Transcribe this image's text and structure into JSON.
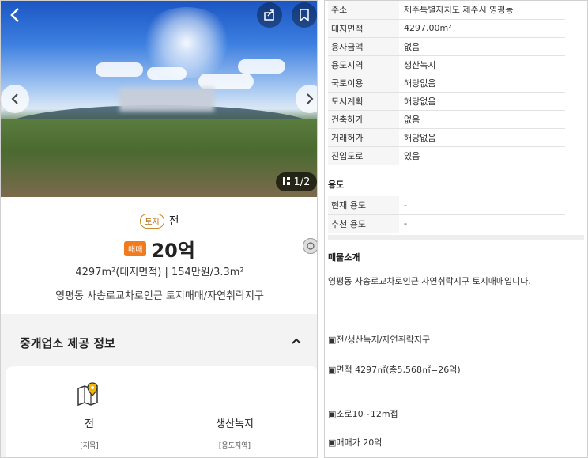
{
  "photo": {
    "counter": "1/2",
    "icons": {
      "back": "chevron-left-icon",
      "share": "share-icon",
      "bookmark": "bookmark-icon",
      "prev": "chevron-left-icon",
      "next": "chevron-right-icon",
      "gallery": "gallery-icon"
    }
  },
  "summary": {
    "land_badge": "토지",
    "type": "전",
    "sale_badge": "매매",
    "price": "20억",
    "area_line": "4297m²(대지면적) | 154만원/3.3m²",
    "desc": "영평동 사송로교차로인근 토지매매/자연취락지구"
  },
  "broker": {
    "title": "중개업소 제공 정보",
    "items": [
      {
        "value": "전",
        "label": "[지목]"
      },
      {
        "value": "생산녹지",
        "label": "[용도지역]"
      }
    ]
  },
  "details": {
    "rows": [
      {
        "k": "주소",
        "v": "제주특별자치도 제주시 영평동"
      },
      {
        "k": "대지면적",
        "v": "4297.00m²"
      },
      {
        "k": "융자금액",
        "v": "없음"
      },
      {
        "k": "용도지역",
        "v": "생산녹지"
      },
      {
        "k": "국토이용",
        "v": "해당없음"
      },
      {
        "k": "도시계획",
        "v": "해당없음"
      },
      {
        "k": "건축허가",
        "v": "없음"
      },
      {
        "k": "거래허가",
        "v": "해당없음"
      },
      {
        "k": "진입도로",
        "v": "있음"
      }
    ],
    "usage_title": "용도",
    "usage_rows": [
      {
        "k": "현재 용도",
        "v": "-"
      },
      {
        "k": "추천 용도",
        "v": "-"
      }
    ],
    "intro_title": "매물소개",
    "intro_lines": [
      "영평동 사송로교차로인근 자연취락지구 토지매매입니다.",
      "▣전/생산녹지/자연취락지구",
      "▣면적 4297㎡(총5,568㎡=26억)",
      "▣소로10~12m접",
      "▣매매가 20억"
    ]
  },
  "colors": {
    "accent": "#f07b1e",
    "badge_border": "#c78a2a"
  }
}
